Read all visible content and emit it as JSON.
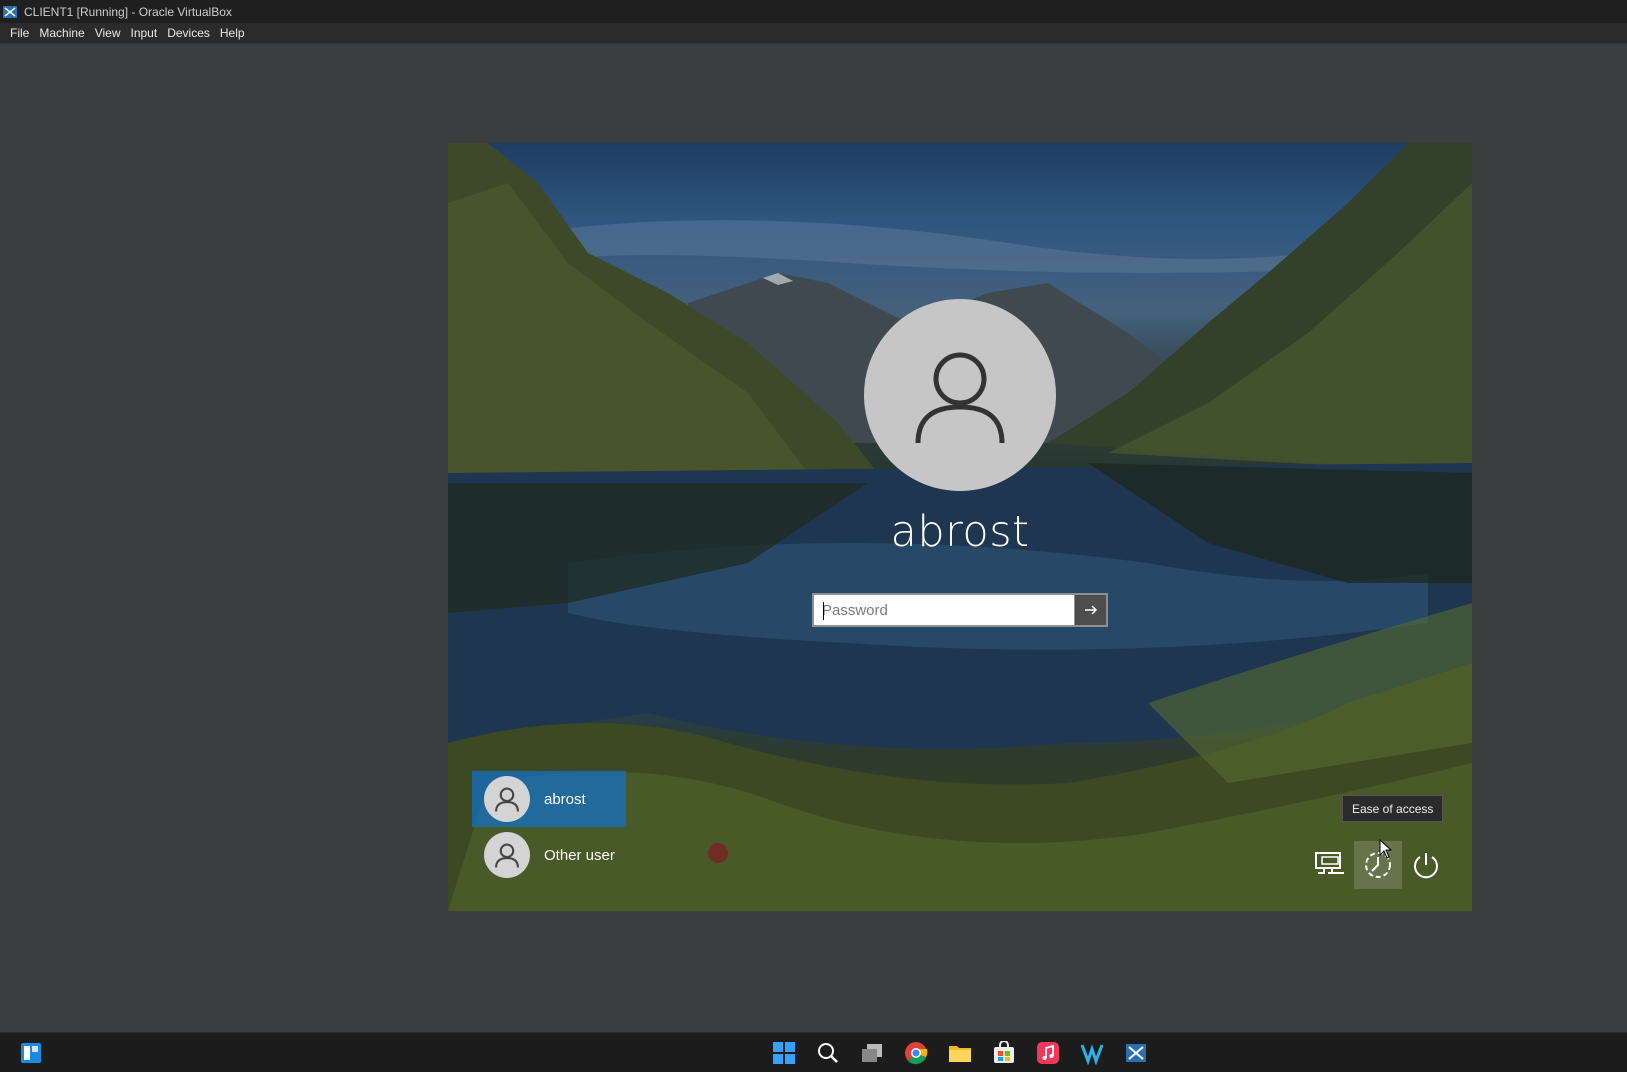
{
  "window": {
    "title": "CLIENT1 [Running] - Oracle VirtualBox",
    "app_icon": "virtualbox-icon"
  },
  "menu": [
    "File",
    "Machine",
    "View",
    "Input",
    "Devices",
    "Help"
  ],
  "login": {
    "username": "abrost",
    "password_placeholder": "Password",
    "submit_icon": "arrow-right-icon",
    "users": [
      {
        "name": "abrost",
        "selected": true
      },
      {
        "name": "Other user",
        "selected": false
      }
    ],
    "tooltip": "Ease of access",
    "system_icons": [
      "network-icon",
      "ease-of-access-icon",
      "power-icon"
    ]
  },
  "taskbar": {
    "icons": [
      "start-icon",
      "search-icon",
      "task-view-icon",
      "chrome-icon",
      "file-explorer-icon",
      "store-icon",
      "music-icon",
      "vscode-icon",
      "virtualbox-icon"
    ],
    "left_icon": "widgets-icon"
  },
  "colors": {
    "selected_tile": "#146ebe",
    "host_background": "#3c3d3f",
    "titlebar": "#1f1f1f",
    "taskbar": "#1c1c1c"
  }
}
